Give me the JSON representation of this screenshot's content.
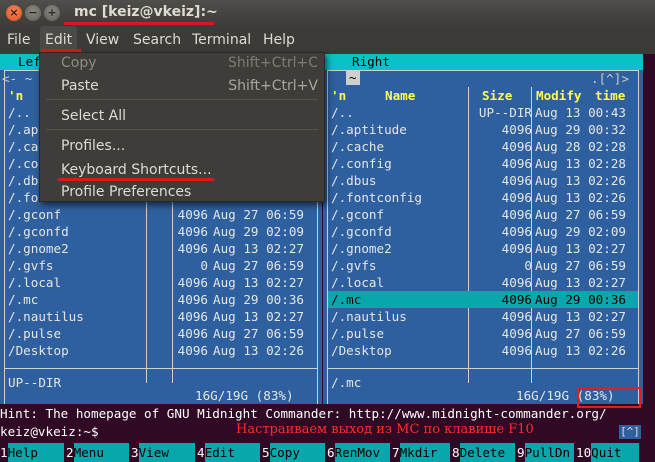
{
  "window": {
    "title": "mc [keiz@vkeiz]:~",
    "close": "×",
    "min": "−",
    "max": "+"
  },
  "menubar": {
    "items": [
      "File",
      "Edit",
      "View",
      "Search",
      "Terminal",
      "Help"
    ]
  },
  "edit_menu": {
    "items": [
      {
        "label": "Copy",
        "accel": "Shift+Ctrl+C",
        "enabled": false
      },
      {
        "label": "Paste",
        "accel": "Shift+Ctrl+V",
        "enabled": true
      },
      {
        "label": "Select All",
        "accel": "",
        "enabled": true
      },
      {
        "label": "Profiles...",
        "accel": "",
        "enabled": true
      },
      {
        "label": "Keyboard Shortcuts...",
        "accel": "",
        "enabled": true
      },
      {
        "label": "Profile Preferences",
        "accel": "",
        "enabled": true
      }
    ]
  },
  "left_panel": {
    "header": "Left",
    "top_left": "<- ~",
    "rows": [
      {
        "name": "/..",
        "size": "",
        "date": ""
      },
      {
        "name": "/.apt",
        "size": "",
        "date": ""
      },
      {
        "name": "/.cac",
        "size": "",
        "date": ""
      },
      {
        "name": "/.con",
        "size": "",
        "date": ""
      },
      {
        "name": "/.dbu",
        "size": "",
        "date": ""
      },
      {
        "name": "/.fon",
        "size": "",
        "date": ""
      },
      {
        "name": "/.gconf",
        "size": "4096",
        "date": "Aug 27 06:59"
      },
      {
        "name": "/.gconfd",
        "size": "4096",
        "date": "Aug 29 02:09"
      },
      {
        "name": "/.gnome2",
        "size": "4096",
        "date": "Aug 13 02:27"
      },
      {
        "name": "/.gvfs",
        "size": "0",
        "date": "Aug 27 06:59"
      },
      {
        "name": "/.local",
        "size": "4096",
        "date": "Aug 13 02:27"
      },
      {
        "name": "/.mc",
        "size": "4096",
        "date": "Aug 29 00:36"
      },
      {
        "name": "/.nautilus",
        "size": "4096",
        "date": "Aug 13 02:27"
      },
      {
        "name": "/.pulse",
        "size": "4096",
        "date": "Aug 27 06:59"
      },
      {
        "name": "/Desktop",
        "size": "4096",
        "date": "Aug 13 02:26"
      }
    ],
    "status": "UP--DIR",
    "disk": "16G/19G (83%)",
    "col_n": "'n"
  },
  "right_panel": {
    "header": "Right",
    "tilde": "~",
    "top_right": ".[^]>",
    "columns": {
      "n": "'n",
      "name": "Name",
      "size": "Size",
      "modify": "Modify",
      "time": "time"
    },
    "rows": [
      {
        "name": "/..",
        "size": "UP--DIR",
        "date": "Aug 13 00:43"
      },
      {
        "name": "/.aptitude",
        "size": "4096",
        "date": "Aug 29 00:32"
      },
      {
        "name": "/.cache",
        "size": "4096",
        "date": "Aug 28 02:28"
      },
      {
        "name": "/.config",
        "size": "4096",
        "date": "Aug 13 02:28"
      },
      {
        "name": "/.dbus",
        "size": "4096",
        "date": "Aug 13 02:26"
      },
      {
        "name": "/.fontconfig",
        "size": "4096",
        "date": "Aug 13 02:26"
      },
      {
        "name": "/.gconf",
        "size": "4096",
        "date": "Aug 27 06:59"
      },
      {
        "name": "/.gconfd",
        "size": "4096",
        "date": "Aug 29 02:09"
      },
      {
        "name": "/.gnome2",
        "size": "4096",
        "date": "Aug 13 02:27"
      },
      {
        "name": "/.gvfs",
        "size": "0",
        "date": "Aug 27 06:59"
      },
      {
        "name": "/.local",
        "size": "4096",
        "date": "Aug 13 02:27"
      },
      {
        "name": "/.mc",
        "size": "4096",
        "date": "Aug 29 00:36"
      },
      {
        "name": "/.nautilus",
        "size": "4096",
        "date": "Aug 13 02:27"
      },
      {
        "name": "/.pulse",
        "size": "4096",
        "date": "Aug 27 06:59"
      },
      {
        "name": "/Desktop",
        "size": "4096",
        "date": "Aug 13 02:26"
      }
    ],
    "selected_index": 11,
    "status": "/.mc",
    "disk": "16G/19G (83%)"
  },
  "hint": "Hint: The homepage of GNU Midnight Commander: http://www.midnight-commander.org/",
  "prompt": "keiz@vkeiz:~$",
  "annotation": "Настраиваем выход из MC по клавише F10",
  "scroll_indicator": "[^]",
  "fkeys": [
    {
      "n": "1",
      "label": "Help"
    },
    {
      "n": "2",
      "label": "Menu"
    },
    {
      "n": "3",
      "label": "View"
    },
    {
      "n": "4",
      "label": "Edit"
    },
    {
      "n": "5",
      "label": "Copy"
    },
    {
      "n": "6",
      "label": "RenMov"
    },
    {
      "n": "7",
      "label": "Mkdir"
    },
    {
      "n": "8",
      "label": "Delete"
    },
    {
      "n": "9",
      "label": "PullDn"
    },
    {
      "n": "10",
      "label": "Quit"
    }
  ],
  "colors": {
    "panel": "#2e5f9e",
    "cyan": "#07a7ab",
    "terminal": "#300a24",
    "highlight": "#d51c1c"
  }
}
